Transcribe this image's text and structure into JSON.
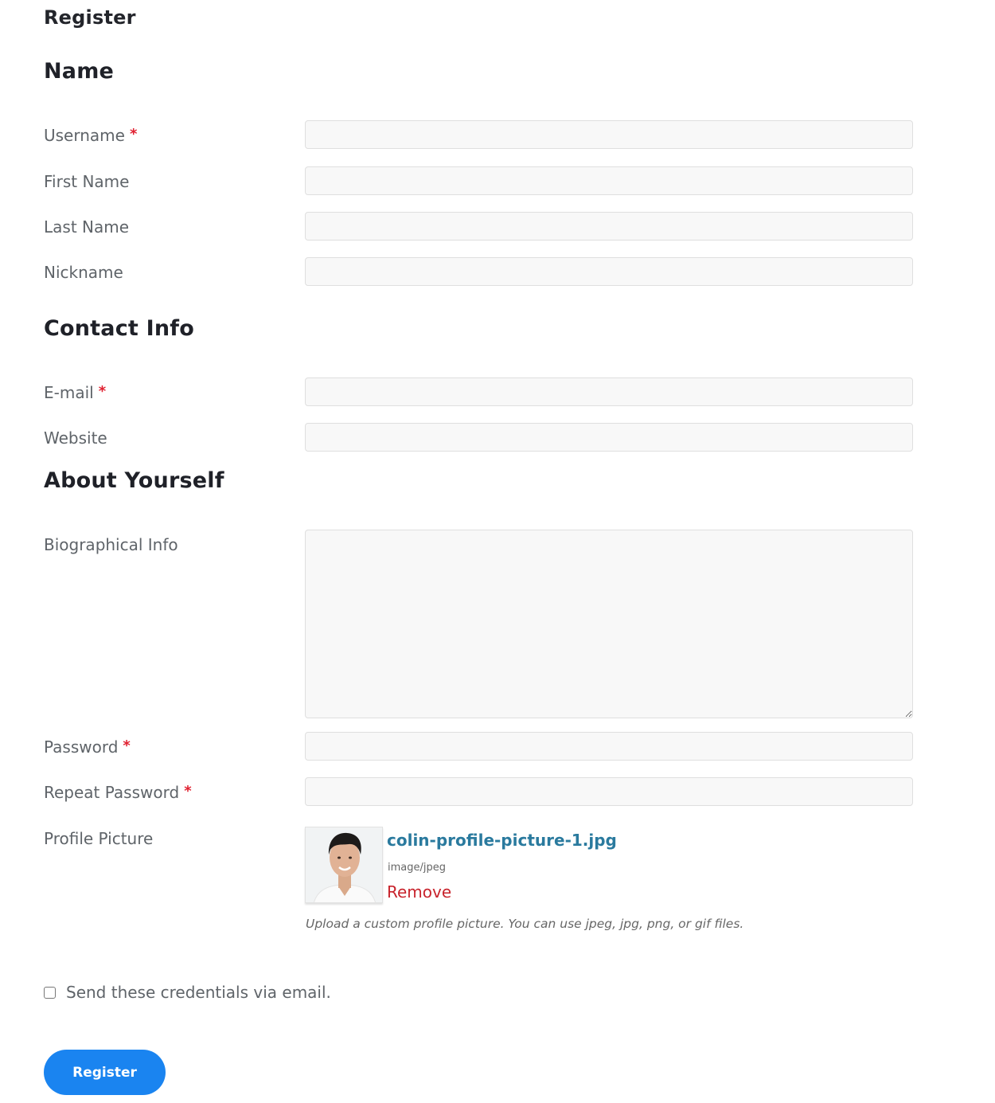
{
  "page": {
    "title": "Register"
  },
  "sections": {
    "name": "Name",
    "contact": "Contact Info",
    "about": "About Yourself"
  },
  "fields": {
    "username": {
      "label": "Username",
      "required_mark": "*",
      "value": ""
    },
    "first_name": {
      "label": "First Name",
      "value": ""
    },
    "last_name": {
      "label": "Last Name",
      "value": ""
    },
    "nickname": {
      "label": "Nickname",
      "value": ""
    },
    "email": {
      "label": "E-mail",
      "required_mark": "*",
      "value": ""
    },
    "website": {
      "label": "Website",
      "value": ""
    },
    "bio": {
      "label": "Biographical Info",
      "value": ""
    },
    "password": {
      "label": "Password",
      "required_mark": "*",
      "value": ""
    },
    "repeat_password": {
      "label": "Repeat Password",
      "required_mark": "*",
      "value": ""
    },
    "profile_picture": {
      "label": "Profile Picture",
      "file_name": "colin-profile-picture-1.jpg",
      "file_type": "image/jpeg",
      "remove_label": "Remove",
      "hint": "Upload a custom profile picture. You can use jpeg, jpg, png, or gif files."
    }
  },
  "send_credentials": {
    "label": "Send these credentials via email.",
    "checked": false
  },
  "submit": {
    "label": "Register"
  },
  "colors": {
    "primary_button": "#1a84f0",
    "required": "#e02030",
    "file_link": "#2a7a9e",
    "remove_link": "#c8232c"
  }
}
